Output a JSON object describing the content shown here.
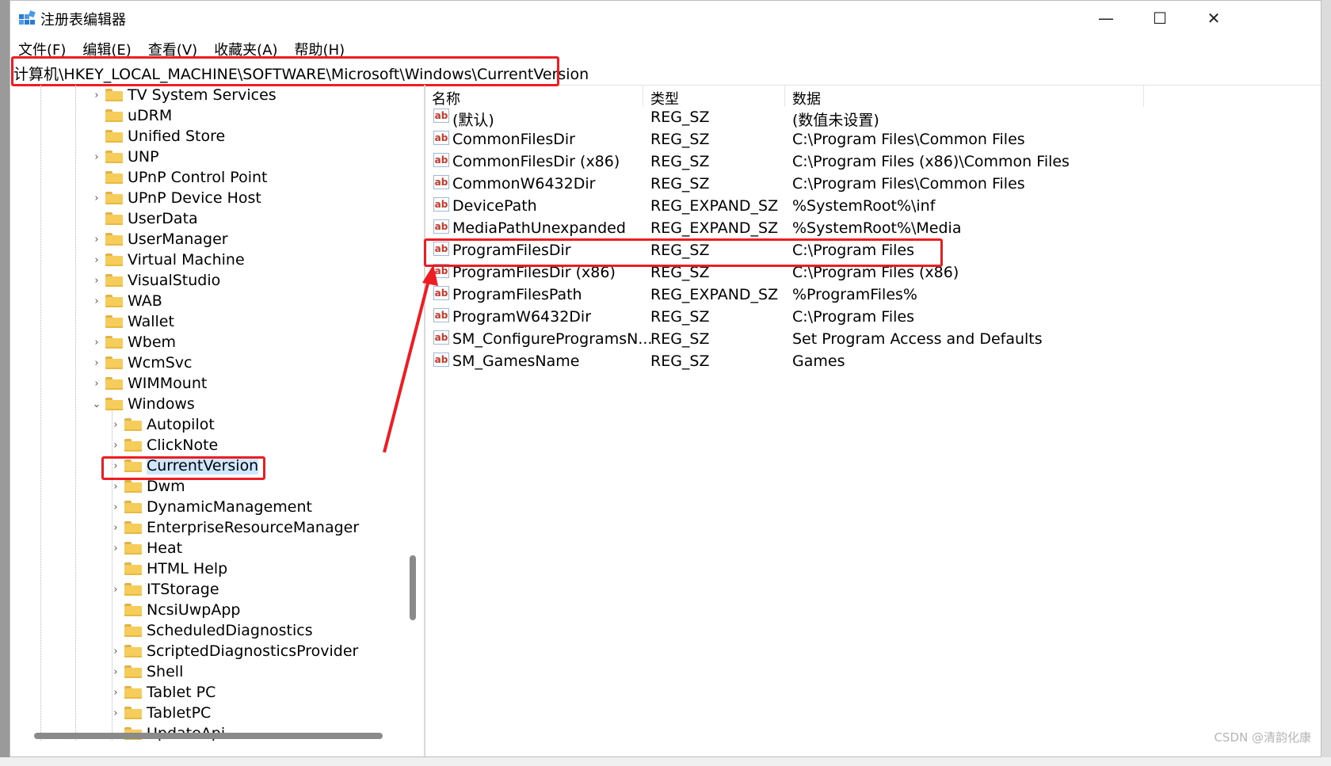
{
  "window": {
    "title": "注册表编辑器",
    "minimize": "—",
    "maximize": "☐",
    "close": "✕"
  },
  "menu": [
    "文件(F)",
    "编辑(E)",
    "查看(V)",
    "收藏夹(A)",
    "帮助(H)"
  ],
  "address": "计算机\\HKEY_LOCAL_MACHINE\\SOFTWARE\\Microsoft\\Windows\\CurrentVersion",
  "tree": {
    "level1": [
      {
        "label": "TV System Services",
        "chevron": "›"
      },
      {
        "label": "uDRM",
        "chevron": ""
      },
      {
        "label": "Unified Store",
        "chevron": ""
      },
      {
        "label": "UNP",
        "chevron": "›"
      },
      {
        "label": "UPnP Control Point",
        "chevron": ""
      },
      {
        "label": "UPnP Device Host",
        "chevron": "›"
      },
      {
        "label": "UserData",
        "chevron": ""
      },
      {
        "label": "UserManager",
        "chevron": "›"
      },
      {
        "label": "Virtual Machine",
        "chevron": "›"
      },
      {
        "label": "VisualStudio",
        "chevron": "›"
      },
      {
        "label": "WAB",
        "chevron": "›"
      },
      {
        "label": "Wallet",
        "chevron": ""
      },
      {
        "label": "Wbem",
        "chevron": "›"
      },
      {
        "label": "WcmSvc",
        "chevron": "›"
      },
      {
        "label": "WIMMount",
        "chevron": "›"
      },
      {
        "label": "Windows",
        "chevron": "⌄"
      }
    ],
    "level2": [
      {
        "label": "Autopilot",
        "chevron": "›"
      },
      {
        "label": "ClickNote",
        "chevron": "›"
      },
      {
        "label": "CurrentVersion",
        "chevron": "›"
      },
      {
        "label": "Dwm",
        "chevron": "›"
      },
      {
        "label": "DynamicManagement",
        "chevron": "›"
      },
      {
        "label": "EnterpriseResourceManager",
        "chevron": "›"
      },
      {
        "label": "Heat",
        "chevron": "›"
      },
      {
        "label": "HTML Help",
        "chevron": ""
      },
      {
        "label": "ITStorage",
        "chevron": "›"
      },
      {
        "label": "NcsiUwpApp",
        "chevron": ""
      },
      {
        "label": "ScheduledDiagnostics",
        "chevron": ""
      },
      {
        "label": "ScriptedDiagnosticsProvider",
        "chevron": "›"
      },
      {
        "label": "Shell",
        "chevron": "›"
      },
      {
        "label": "Tablet PC",
        "chevron": "›"
      },
      {
        "label": "TabletPC",
        "chevron": "›"
      },
      {
        "label": "UpdateApi",
        "chevron": ""
      }
    ],
    "selected": "CurrentVersion"
  },
  "list": {
    "headers": [
      "名称",
      "类型",
      "数据"
    ],
    "icon_text": "ab",
    "rows": [
      {
        "name": "(默认)",
        "type": "REG_SZ",
        "data": "(数值未设置)"
      },
      {
        "name": "CommonFilesDir",
        "type": "REG_SZ",
        "data": "C:\\Program Files\\Common Files"
      },
      {
        "name": "CommonFilesDir (x86)",
        "type": "REG_SZ",
        "data": "C:\\Program Files (x86)\\Common Files"
      },
      {
        "name": "CommonW6432Dir",
        "type": "REG_SZ",
        "data": "C:\\Program Files\\Common Files"
      },
      {
        "name": "DevicePath",
        "type": "REG_EXPAND_SZ",
        "data": "%SystemRoot%\\inf"
      },
      {
        "name": "MediaPathUnexpanded",
        "type": "REG_EXPAND_SZ",
        "data": "%SystemRoot%\\Media"
      },
      {
        "name": "ProgramFilesDir",
        "type": "REG_SZ",
        "data": "C:\\Program Files"
      },
      {
        "name": "ProgramFilesDir (x86)",
        "type": "REG_SZ",
        "data": "C:\\Program Files (x86)"
      },
      {
        "name": "ProgramFilesPath",
        "type": "REG_EXPAND_SZ",
        "data": "%ProgramFiles%"
      },
      {
        "name": "ProgramW6432Dir",
        "type": "REG_SZ",
        "data": "C:\\Program Files"
      },
      {
        "name": "SM_ConfigureProgramsN...",
        "type": "REG_SZ",
        "data": "Set Program Access and Defaults"
      },
      {
        "name": "SM_GamesName",
        "type": "REG_SZ",
        "data": "Games"
      }
    ]
  },
  "watermark": "CSDN @清韵化康",
  "colors": {
    "highlight": "#ee1d23",
    "selection": "#cde8ff",
    "folder": "#f6cd5b"
  }
}
